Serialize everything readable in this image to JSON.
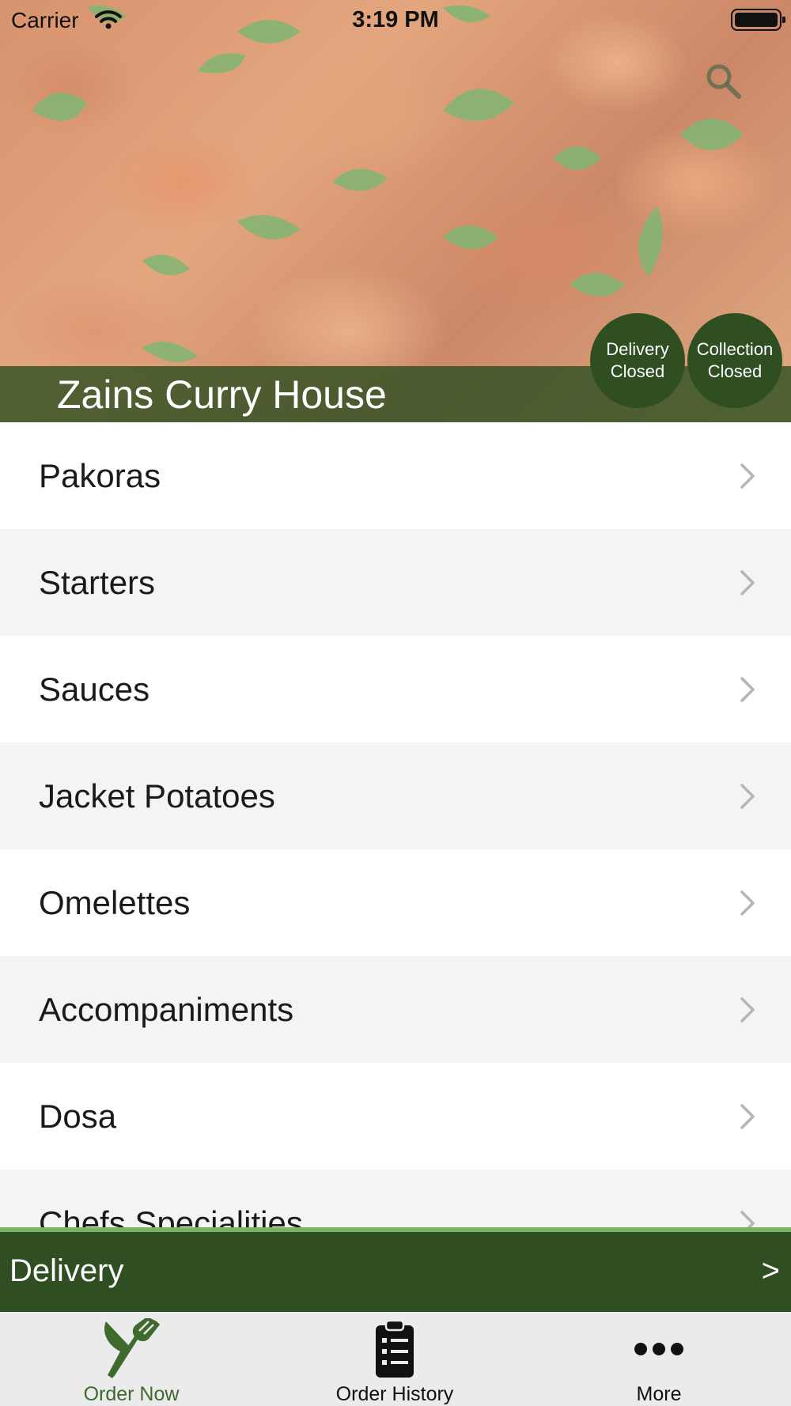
{
  "status_bar": {
    "carrier": "Carrier",
    "time": "3:19 PM"
  },
  "header": {
    "store_name": "Zains Curry House",
    "search_icon": "search-icon",
    "delivery_status": {
      "line1": "Delivery",
      "line2": "Closed"
    },
    "collection_status": {
      "line1": "Collection",
      "line2": "Closed"
    }
  },
  "menu": {
    "categories": [
      "Pakoras",
      "Starters",
      "Sauces",
      "Jacket Potatoes",
      "Omelettes",
      "Accompaniments",
      "Dosa",
      "Chefs Specialities"
    ],
    "chevron_icon": "chevron-right-icon"
  },
  "order_mode": {
    "label": "Delivery",
    "arrow": ">"
  },
  "tab_bar": {
    "tabs": [
      {
        "label": "Order Now",
        "icon": "fork-knife-icon",
        "active": true
      },
      {
        "label": "Order History",
        "icon": "clipboard-list-icon",
        "active": false
      },
      {
        "label": "More",
        "icon": "more-dots-icon",
        "active": false
      }
    ]
  },
  "colors": {
    "brand_dark_green": "#2f4f23",
    "accent_light_green": "#7cb263",
    "active_tab": "#3e6a2e",
    "inactive_tab": "#111111"
  }
}
